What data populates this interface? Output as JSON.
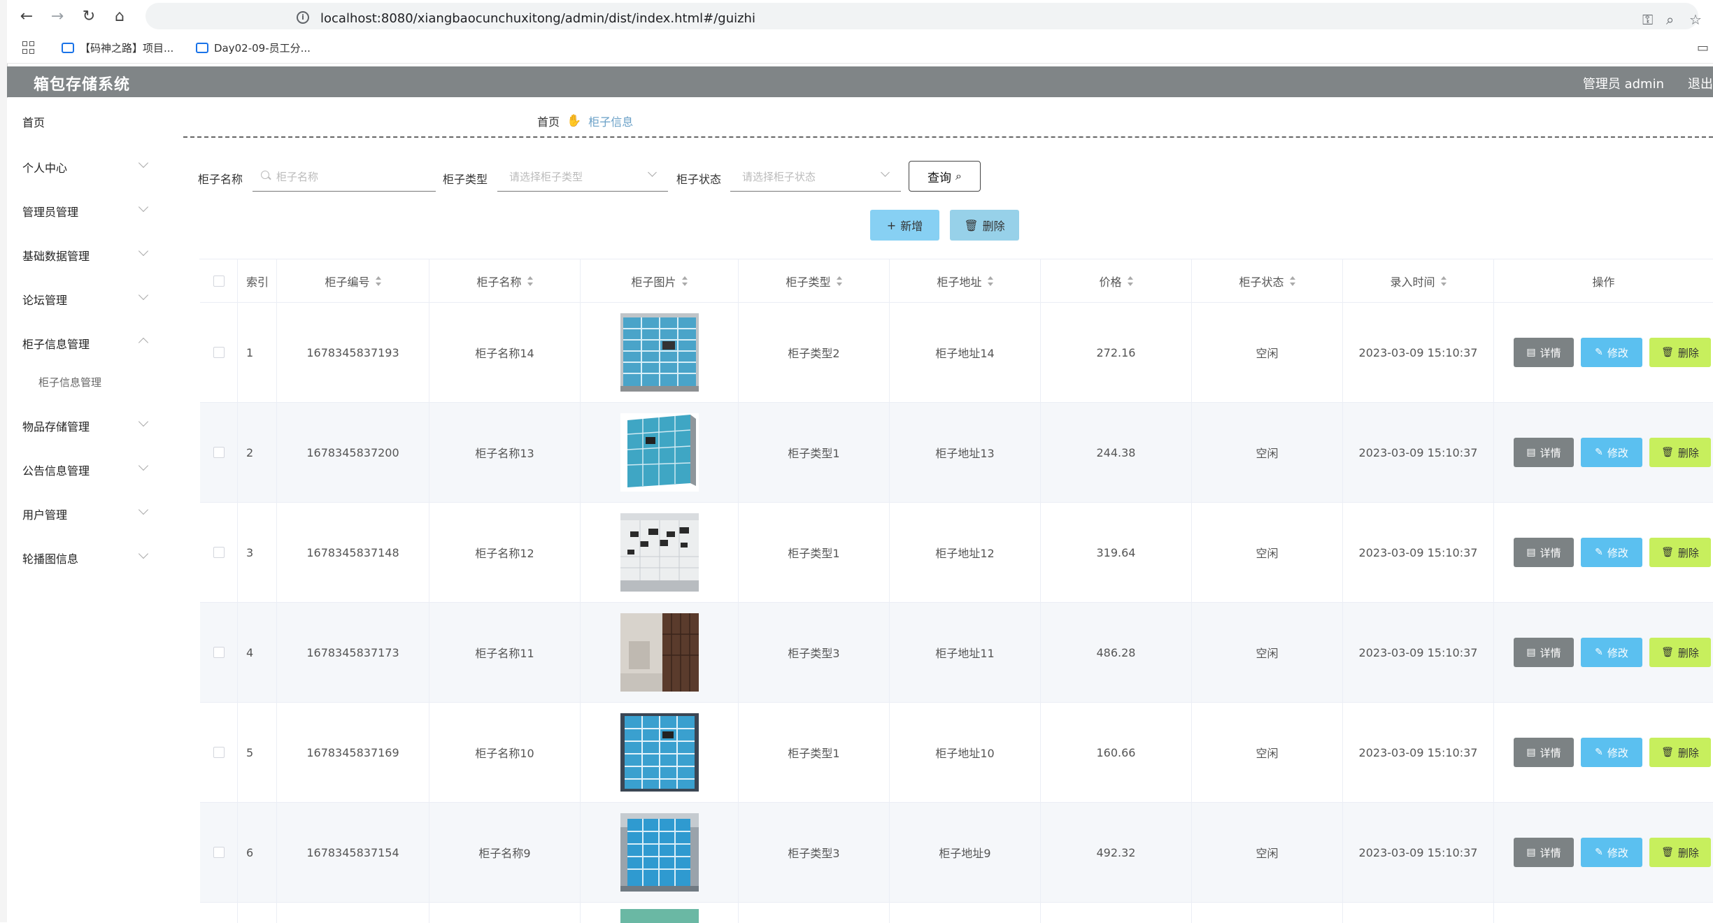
{
  "browser": {
    "url": "localhost:8080/xiangbaocunchuxitong/admin/dist/index.html#/guizhi",
    "bookmarks": [
      "【码神之路】项目...",
      "Day02-09-员工分..."
    ]
  },
  "app": {
    "title": "箱包存储系统",
    "user_label": "管理员 admin",
    "logout_label": "退出"
  },
  "sidebar": {
    "items": [
      {
        "label": "首页"
      },
      {
        "label": "个人中心"
      },
      {
        "label": "管理员管理"
      },
      {
        "label": "基础数据管理"
      },
      {
        "label": "论坛管理"
      },
      {
        "label": "柜子信息管理"
      },
      {
        "label": "物品存储管理"
      },
      {
        "label": "公告信息管理"
      },
      {
        "label": "用户管理"
      },
      {
        "label": "轮播图信息"
      }
    ],
    "subitem": "柜子信息管理"
  },
  "breadcrumb": {
    "home": "首页",
    "current": "柜子信息"
  },
  "filters": {
    "name_label": "柜子名称",
    "name_placeholder": "柜子名称",
    "type_label": "柜子类型",
    "type_placeholder": "请选择柜子类型",
    "status_label": "柜子状态",
    "status_placeholder": "请选择柜子状态",
    "query_label": "查询"
  },
  "actions": {
    "add_label": "新增",
    "delete_label": "删除"
  },
  "table": {
    "headers": [
      "索引",
      "柜子编号",
      "柜子名称",
      "柜子图片",
      "柜子类型",
      "柜子地址",
      "价格",
      "柜子状态",
      "录入时间",
      "操作"
    ],
    "rows": [
      {
        "index": "1",
        "code": "1678345837193",
        "name": "柜子名称14",
        "type": "柜子类型2",
        "address": "柜子地址14",
        "price": "272.16",
        "status": "空闲",
        "time": "2023-03-09 15:10:37",
        "img": "lockers-blue-grid"
      },
      {
        "index": "2",
        "code": "1678345837200",
        "name": "柜子名称13",
        "type": "柜子类型1",
        "address": "柜子地址13",
        "price": "244.38",
        "status": "空闲",
        "time": "2023-03-09 15:10:37",
        "img": "lockers-blue-angle"
      },
      {
        "index": "3",
        "code": "1678345837148",
        "name": "柜子名称12",
        "type": "柜子类型1",
        "address": "柜子地址12",
        "price": "319.64",
        "status": "空闲",
        "time": "2023-03-09 15:10:37",
        "img": "lockers-white"
      },
      {
        "index": "4",
        "code": "1678345837173",
        "name": "柜子名称11",
        "type": "柜子类型3",
        "address": "柜子地址11",
        "price": "486.28",
        "status": "空闲",
        "time": "2023-03-09 15:10:37",
        "img": "lockers-wood-room"
      },
      {
        "index": "5",
        "code": "1678345837169",
        "name": "柜子名称10",
        "type": "柜子类型1",
        "address": "柜子地址10",
        "price": "160.66",
        "status": "空闲",
        "time": "2023-03-09 15:10:37",
        "img": "lockers-blue-hall"
      },
      {
        "index": "6",
        "code": "1678345837154",
        "name": "柜子名称9",
        "type": "柜子类型3",
        "address": "柜子地址9",
        "price": "492.32",
        "status": "空闲",
        "time": "2023-03-09 15:10:37",
        "img": "lockers-blue-outdoor"
      }
    ],
    "btn_detail": "详情",
    "btn_edit": "修改",
    "btn_delete": "删除"
  },
  "colors": {
    "header_bg": "#808587",
    "edit_btn": "#5bc0f0",
    "delete_btn": "#c7ef5d",
    "detail_btn": "#7c8284",
    "add_btn": "#87d0f3"
  }
}
